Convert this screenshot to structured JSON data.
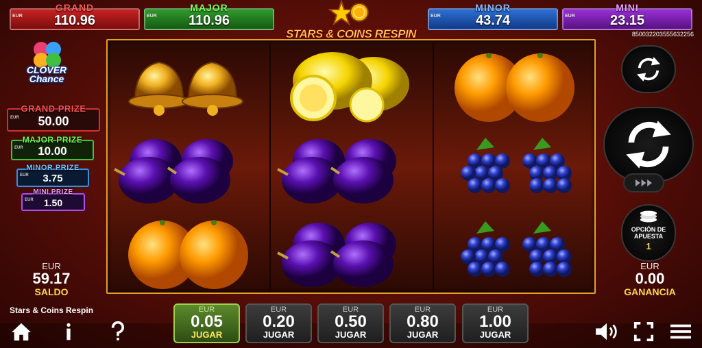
{
  "jackpots": {
    "currency": "EUR",
    "grand": {
      "name": "GRAND",
      "value": "110.96"
    },
    "major": {
      "name": "MAJOR",
      "value": "110.96"
    },
    "minor": {
      "name": "MINOR",
      "value": "43.74"
    },
    "mini": {
      "name": "MINI",
      "value": "23.15"
    }
  },
  "game_id": "850032203555632256",
  "logo": {
    "title": "STARS & COINS RESPIN"
  },
  "clover_logo": {
    "line1": "CLOVER",
    "line2": "Chance"
  },
  "prizes": {
    "currency": "EUR",
    "grand": {
      "name": "GRAND PRIZE",
      "value": "50.00"
    },
    "major": {
      "name": "MAJOR PRIZE",
      "value": "10.00"
    },
    "minor": {
      "name": "MINOR PRIZE",
      "value": "3.75"
    },
    "mini": {
      "name": "MINI PRIZE",
      "value": "1.50"
    }
  },
  "balance": {
    "currency": "EUR",
    "amount": "59.17",
    "label": "SALDO"
  },
  "game_name": "Stars & Coins Respin",
  "reels": [
    [
      "bells",
      "plums",
      "oranges"
    ],
    [
      "lemons",
      "plums",
      "plums"
    ],
    [
      "oranges",
      "grapes",
      "grapes"
    ]
  ],
  "bet_option": {
    "label_line1": "OPCIÓN DE",
    "label_line2": "APUESTA",
    "value": "1"
  },
  "win": {
    "currency": "EUR",
    "amount": "0.00",
    "label": "GANANCIA"
  },
  "bet_buttons": [
    {
      "currency": "EUR",
      "value": "0.05",
      "action": "JUGAR",
      "active": true
    },
    {
      "currency": "EUR",
      "value": "0.20",
      "action": "JUGAR",
      "active": false
    },
    {
      "currency": "EUR",
      "value": "0.50",
      "action": "JUGAR",
      "active": false
    },
    {
      "currency": "EUR",
      "value": "0.80",
      "action": "JUGAR",
      "active": false
    },
    {
      "currency": "EUR",
      "value": "1.00",
      "action": "JUGAR",
      "active": false
    }
  ],
  "icons": {
    "home": "home-icon",
    "info": "info-icon",
    "help": "question-icon",
    "sound": "speaker-icon",
    "fullscreen": "fullscreen-icon",
    "menu": "hamburger-icon",
    "autoplay": "autoplay-icon",
    "spin": "spin-icon",
    "fast": "fast-forward-icon",
    "coins": "coins-icon"
  },
  "colors": {
    "grand": "#c82222",
    "major": "#2f9a2c",
    "minor": "#2d6fd6",
    "mini": "#9a2fd6",
    "frame": "#e8a020",
    "accent": "#ffd84a"
  }
}
